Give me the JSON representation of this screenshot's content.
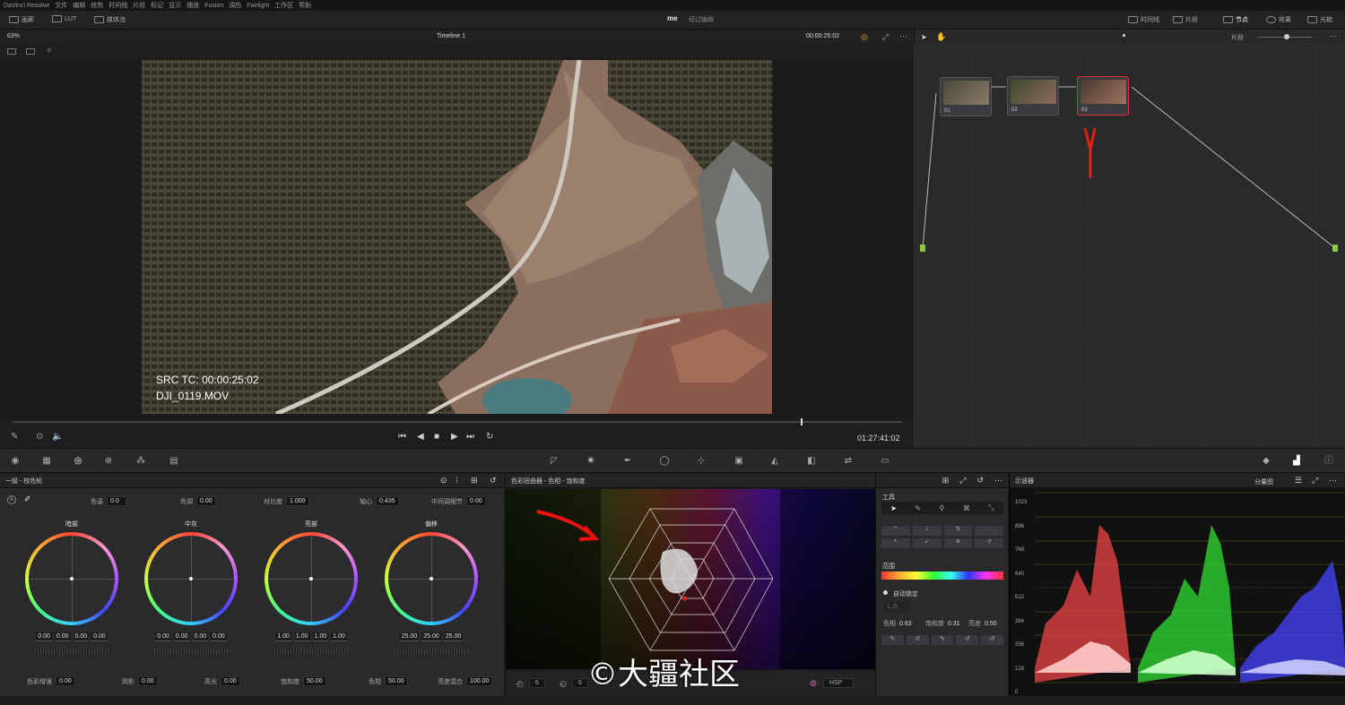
{
  "menubar": {
    "items": [
      "DaVinci Resolve",
      "文件",
      "编辑",
      "修剪",
      "时间线",
      "片段",
      "标记",
      "显示",
      "播放",
      "Fusion",
      "调色",
      "Fairlight",
      "工作区",
      "帮助"
    ]
  },
  "toolbar": {
    "left": [
      {
        "icon": "gallery-icon",
        "label": "画廊"
      },
      {
        "icon": "lut-icon",
        "label": "LUT"
      },
      {
        "icon": "media-icon",
        "label": "媒体池"
      }
    ],
    "project": "me",
    "status": "经过编辑",
    "right": [
      {
        "icon": "timeline-icon",
        "label": "时间线"
      },
      {
        "icon": "clips-icon",
        "label": "片段"
      },
      {
        "icon": "nodes-icon",
        "label": "节点"
      },
      {
        "icon": "fx-icon",
        "label": "效果"
      },
      {
        "icon": "lightbox-icon",
        "label": "光箱"
      }
    ]
  },
  "viewer": {
    "zoom": "63%",
    "timeline": "Timeline 1",
    "timecode": "00:00:25:02",
    "src_tc": "SRC TC: 00:00:25:02",
    "clip_name": "DJI_0119.MOV",
    "duration_tc": "01:27:41:02"
  },
  "nodes": {
    "mode": "片段",
    "items": [
      {
        "label": "01"
      },
      {
        "label": "02"
      },
      {
        "label": "03"
      }
    ]
  },
  "wheels_panel": {
    "title": "一级 - 校色轮",
    "params_top": [
      {
        "label": "色温",
        "value": "0.0"
      },
      {
        "label": "色调",
        "value": "0.00"
      },
      {
        "label": "对比度",
        "value": "1.000"
      },
      {
        "label": "轴心",
        "value": "0.435"
      },
      {
        "label": "中间调细节",
        "value": "0.00"
      }
    ],
    "wheels": [
      {
        "title": "暗部",
        "values": [
          "0.00",
          "0.00",
          "0.00",
          "0.00"
        ]
      },
      {
        "title": "中灰",
        "values": [
          "0.00",
          "0.00",
          "0.00",
          "0.00"
        ]
      },
      {
        "title": "亮部",
        "values": [
          "1.00",
          "1.00",
          "1.00",
          "1.00"
        ]
      },
      {
        "title": "偏移",
        "values": [
          "25.00",
          "25.00",
          "25.00"
        ]
      }
    ],
    "params_bottom": [
      {
        "label": "色彩增强",
        "value": "0.00"
      },
      {
        "label": "阴影",
        "value": "0.00"
      },
      {
        "label": "高光",
        "value": "0.00"
      },
      {
        "label": "饱和度",
        "value": "50.00"
      },
      {
        "label": "色相",
        "value": "50.00"
      },
      {
        "label": "亮度混合",
        "value": "100.00"
      }
    ]
  },
  "warper": {
    "title": "色彩扭曲器 - 色相 - 饱和度",
    "grid_a": "6",
    "grid_b": "6",
    "mode": "HSP"
  },
  "warper_tools": {
    "title": "工具",
    "range_label": "范围",
    "auto_label": "自动锁定",
    "dropdown": "1 点",
    "values": [
      {
        "label": "色相",
        "value": "0.63"
      },
      {
        "label": "饱和度",
        "value": "0.31"
      },
      {
        "label": "亮度",
        "value": "0.50"
      }
    ]
  },
  "scope": {
    "title": "示波器",
    "mode": "分量图",
    "ticks": [
      "1023",
      "896",
      "768",
      "640",
      "512",
      "384",
      "256",
      "128",
      "0"
    ]
  },
  "watermark": "©大疆社区"
}
